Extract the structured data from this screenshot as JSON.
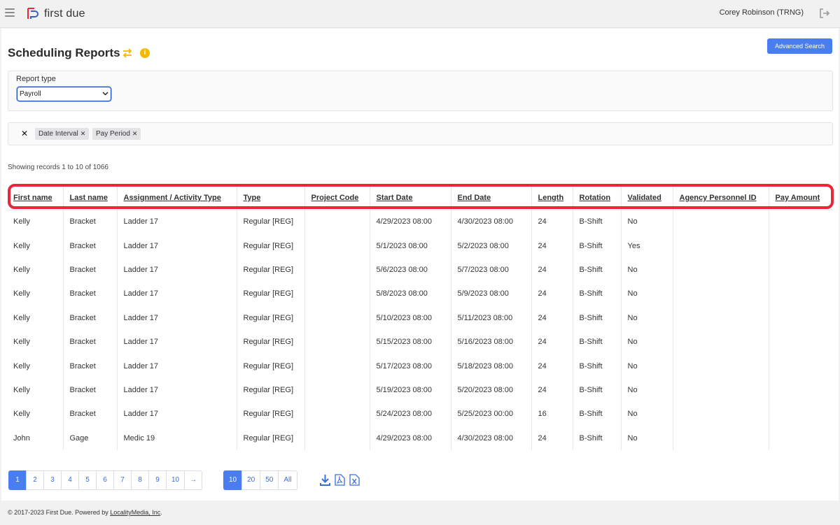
{
  "header": {
    "brand": "first due",
    "user": "Corey Robinson (TRNG)"
  },
  "page": {
    "title": "Scheduling Reports",
    "advanced_search": "Advanced Search",
    "report_type_label": "Report type",
    "report_type_value": "Payroll",
    "filters": [
      "Date Interval",
      "Pay Period"
    ],
    "record_count": "Showing records 1 to 10 of 1066"
  },
  "table": {
    "columns": [
      "First name",
      "Last name",
      "Assignment / Activity Type",
      "Type",
      "Project Code",
      "Start Date",
      "End Date",
      "Length",
      "Rotation",
      "Validated",
      "Agency Personnel ID",
      "Pay Amount"
    ],
    "rows": [
      [
        "Kelly",
        "Bracket",
        "Ladder 17",
        "Regular [REG]",
        "",
        "4/29/2023 08:00",
        "4/30/2023 08:00",
        "24",
        "B-Shift",
        "No",
        "",
        ""
      ],
      [
        "Kelly",
        "Bracket",
        "Ladder 17",
        "Regular [REG]",
        "",
        "5/1/2023 08:00",
        "5/2/2023 08:00",
        "24",
        "B-Shift",
        "Yes",
        "",
        ""
      ],
      [
        "Kelly",
        "Bracket",
        "Ladder 17",
        "Regular [REG]",
        "",
        "5/6/2023 08:00",
        "5/7/2023 08:00",
        "24",
        "B-Shift",
        "No",
        "",
        ""
      ],
      [
        "Kelly",
        "Bracket",
        "Ladder 17",
        "Regular [REG]",
        "",
        "5/8/2023 08:00",
        "5/9/2023 08:00",
        "24",
        "B-Shift",
        "No",
        "",
        ""
      ],
      [
        "Kelly",
        "Bracket",
        "Ladder 17",
        "Regular [REG]",
        "",
        "5/10/2023 08:00",
        "5/11/2023 08:00",
        "24",
        "B-Shift",
        "No",
        "",
        ""
      ],
      [
        "Kelly",
        "Bracket",
        "Ladder 17",
        "Regular [REG]",
        "",
        "5/15/2023 08:00",
        "5/16/2023 08:00",
        "24",
        "B-Shift",
        "No",
        "",
        ""
      ],
      [
        "Kelly",
        "Bracket",
        "Ladder 17",
        "Regular [REG]",
        "",
        "5/17/2023 08:00",
        "5/18/2023 08:00",
        "24",
        "B-Shift",
        "No",
        "",
        ""
      ],
      [
        "Kelly",
        "Bracket",
        "Ladder 17",
        "Regular [REG]",
        "",
        "5/19/2023 08:00",
        "5/20/2023 08:00",
        "24",
        "B-Shift",
        "No",
        "",
        ""
      ],
      [
        "Kelly",
        "Bracket",
        "Ladder 17",
        "Regular [REG]",
        "",
        "5/24/2023 08:00",
        "5/25/2023 00:00",
        "16",
        "B-Shift",
        "No",
        "",
        ""
      ],
      [
        "John",
        "Gage",
        "Medic 19",
        "Regular [REG]",
        "",
        "4/29/2023 08:00",
        "4/30/2023 08:00",
        "24",
        "B-Shift",
        "No",
        "",
        ""
      ]
    ]
  },
  "pagination": {
    "pages": [
      "1",
      "2",
      "3",
      "4",
      "5",
      "6",
      "7",
      "8",
      "9",
      "10",
      "→"
    ],
    "active_page": "1",
    "page_sizes": [
      "10",
      "20",
      "50",
      "All"
    ],
    "active_size": "10",
    "download_icons": [
      "download-icon",
      "pdf-icon",
      "excel-icon"
    ]
  },
  "footer": {
    "text": "© 2017-2023 First Due. Powered by ",
    "link": "LocalityMedia, Inc",
    "suffix": "."
  },
  "colors": {
    "accent": "#4a7ef0",
    "highlight": "#e8283a",
    "info": "#f5b800",
    "swap": "#f5b800",
    "logo_red": "#e8283a",
    "logo_blue": "#3b5fc4"
  }
}
